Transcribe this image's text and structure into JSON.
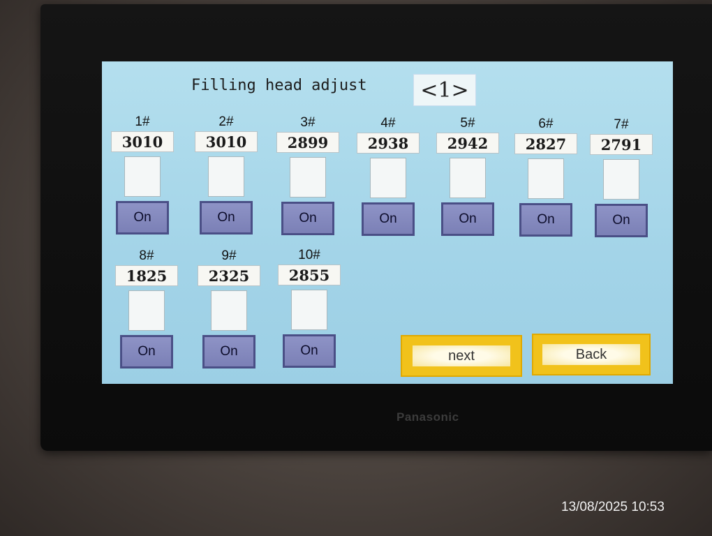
{
  "device": {
    "brand": "Panasonic"
  },
  "screen": {
    "title": "Filling head adjust",
    "page_indicator": "<1>",
    "heads": [
      {
        "label": "1#",
        "value": "3010",
        "button": "On"
      },
      {
        "label": "2#",
        "value": "3010",
        "button": "On"
      },
      {
        "label": "3#",
        "value": "2899",
        "button": "On"
      },
      {
        "label": "4#",
        "value": "2938",
        "button": "On"
      },
      {
        "label": "5#",
        "value": "2942",
        "button": "On"
      },
      {
        "label": "6#",
        "value": "2827",
        "button": "On"
      },
      {
        "label": "7#",
        "value": "2791",
        "button": "On"
      },
      {
        "label": "8#",
        "value": "1825",
        "button": "On"
      },
      {
        "label": "9#",
        "value": "2325",
        "button": "On"
      },
      {
        "label": "10#",
        "value": "2855",
        "button": "On"
      }
    ],
    "next_label": "next",
    "back_label": "Back"
  },
  "photo": {
    "timestamp": "13/08/2025 10:53"
  }
}
